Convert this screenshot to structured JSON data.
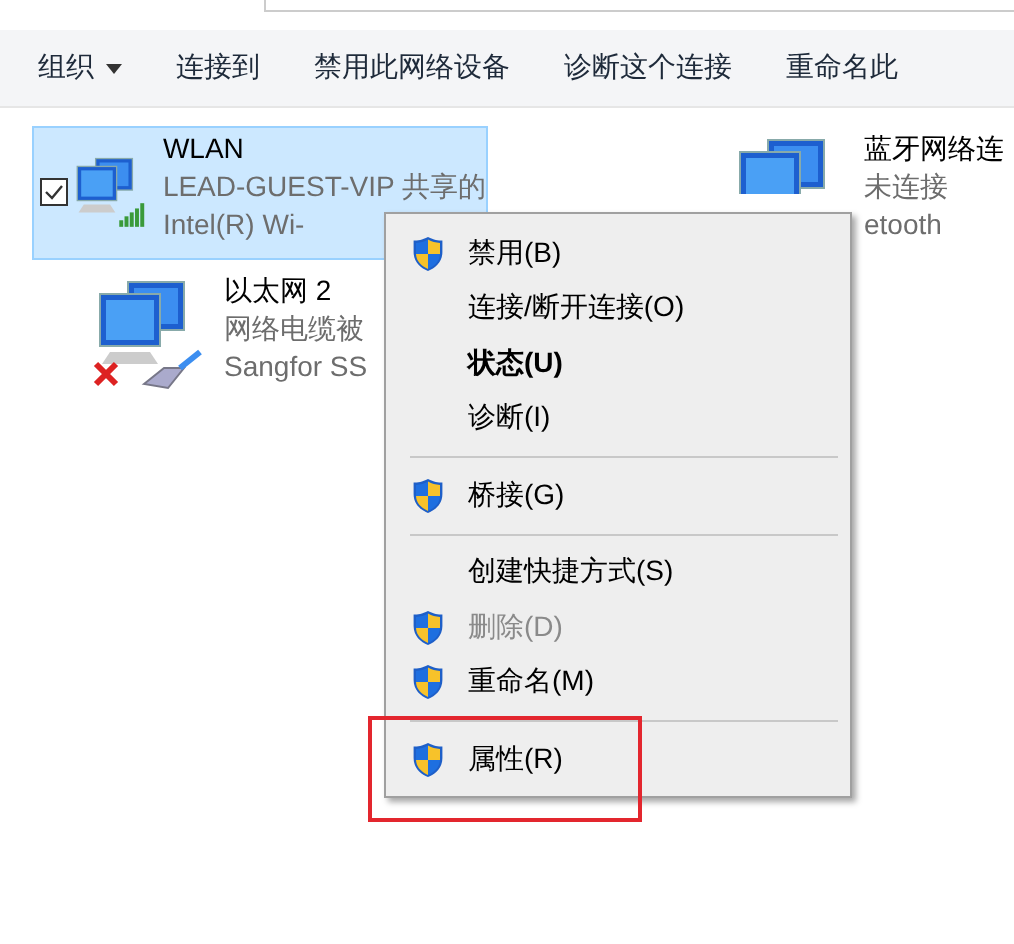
{
  "toolbar": [
    {
      "label": "组织",
      "dropdown": true
    },
    {
      "label": "连接到",
      "dropdown": false
    },
    {
      "label": "禁用此网络设备",
      "dropdown": false
    },
    {
      "label": "诊断这个连接",
      "dropdown": false
    },
    {
      "label": "重命名此",
      "dropdown": false
    }
  ],
  "adapters": [
    {
      "name": "WLAN",
      "status": "LEAD-GUEST-VIP 共享的",
      "device": "Intel(R) Wi-",
      "kind": "wifi",
      "selected": true,
      "checked": true
    },
    {
      "name": "蓝牙网络连",
      "status": "未连接",
      "device": "etooth",
      "kind": "bluetooth",
      "selected": false,
      "checked": false
    },
    {
      "name": "以太网 2",
      "status": "网络电缆被",
      "device": "Sangfor SS",
      "kind": "ethernet",
      "selected": false,
      "checked": false
    }
  ],
  "context_menu": [
    {
      "kind": "item",
      "label": "禁用(B)",
      "shield": true,
      "bold": false,
      "disabled": false,
      "highlighted": false
    },
    {
      "kind": "item",
      "label": "连接/断开连接(O)",
      "shield": false,
      "bold": false,
      "disabled": false,
      "highlighted": false
    },
    {
      "kind": "item",
      "label": "状态(U)",
      "shield": false,
      "bold": true,
      "disabled": false,
      "highlighted": false
    },
    {
      "kind": "item",
      "label": "诊断(I)",
      "shield": false,
      "bold": false,
      "disabled": false,
      "highlighted": false
    },
    {
      "kind": "separator"
    },
    {
      "kind": "item",
      "label": "桥接(G)",
      "shield": true,
      "bold": false,
      "disabled": false,
      "highlighted": false
    },
    {
      "kind": "separator"
    },
    {
      "kind": "item",
      "label": "创建快捷方式(S)",
      "shield": false,
      "bold": false,
      "disabled": false,
      "highlighted": false
    },
    {
      "kind": "item",
      "label": "删除(D)",
      "shield": true,
      "bold": false,
      "disabled": true,
      "highlighted": false
    },
    {
      "kind": "item",
      "label": "重命名(M)",
      "shield": true,
      "bold": false,
      "disabled": false,
      "highlighted": false
    },
    {
      "kind": "separator"
    },
    {
      "kind": "item",
      "label": "属性(R)",
      "shield": true,
      "bold": false,
      "disabled": false,
      "highlighted": true
    }
  ]
}
